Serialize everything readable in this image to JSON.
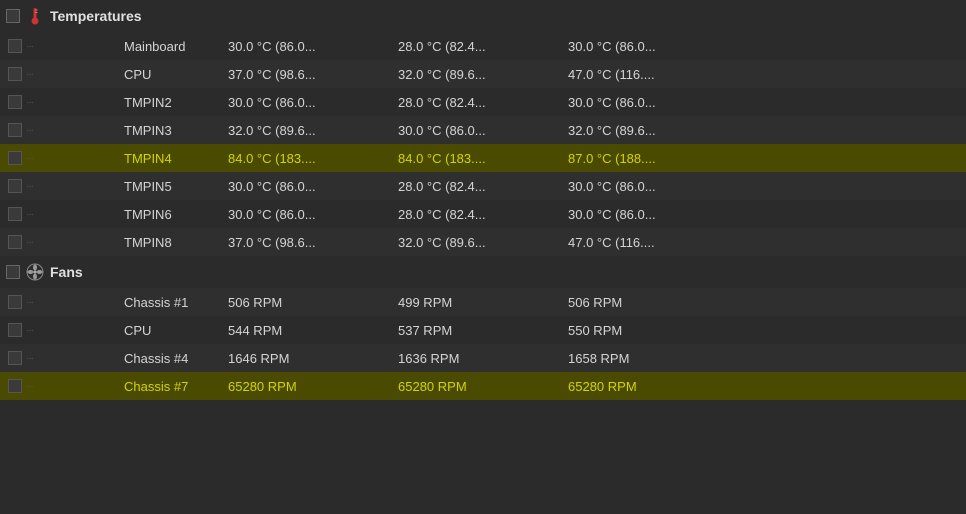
{
  "sections": [
    {
      "id": "temperatures",
      "label": "Temperatures",
      "icon": "thermometer",
      "rows": [
        {
          "name": "Mainboard",
          "col1": "30.0 °C (86.0...",
          "col2": "28.0 °C (82.4...",
          "col3": "30.0 °C (86.0...",
          "highlighted": false
        },
        {
          "name": "CPU",
          "col1": "37.0 °C (98.6...",
          "col2": "32.0 °C (89.6...",
          "col3": "47.0 °C (116....",
          "highlighted": false
        },
        {
          "name": "TMPIN2",
          "col1": "30.0 °C (86.0...",
          "col2": "28.0 °C (82.4...",
          "col3": "30.0 °C (86.0...",
          "highlighted": false
        },
        {
          "name": "TMPIN3",
          "col1": "32.0 °C (89.6...",
          "col2": "30.0 °C (86.0...",
          "col3": "32.0 °C (89.6...",
          "highlighted": false
        },
        {
          "name": "TMPIN4",
          "col1": "84.0 °C (183....",
          "col2": "84.0 °C (183....",
          "col3": "87.0 °C (188....",
          "highlighted": true
        },
        {
          "name": "TMPIN5",
          "col1": "30.0 °C (86.0...",
          "col2": "28.0 °C (82.4...",
          "col3": "30.0 °C (86.0...",
          "highlighted": false
        },
        {
          "name": "TMPIN6",
          "col1": "30.0 °C (86.0...",
          "col2": "28.0 °C (82.4...",
          "col3": "30.0 °C (86.0...",
          "highlighted": false
        },
        {
          "name": "TMPIN8",
          "col1": "37.0 °C (98.6...",
          "col2": "32.0 °C (89.6...",
          "col3": "47.0 °C (116....",
          "highlighted": false
        }
      ]
    },
    {
      "id": "fans",
      "label": "Fans",
      "icon": "fan",
      "rows": [
        {
          "name": "Chassis #1",
          "col1": "506 RPM",
          "col2": "499 RPM",
          "col3": "506 RPM",
          "highlighted": false
        },
        {
          "name": "CPU",
          "col1": "544 RPM",
          "col2": "537 RPM",
          "col3": "550 RPM",
          "highlighted": false
        },
        {
          "name": "Chassis #4",
          "col1": "1646 RPM",
          "col2": "1636 RPM",
          "col3": "1658 RPM",
          "highlighted": false
        },
        {
          "name": "Chassis #7",
          "col1": "65280 RPM",
          "col2": "65280 RPM",
          "col3": "65280 RPM",
          "highlighted": true
        }
      ]
    }
  ]
}
